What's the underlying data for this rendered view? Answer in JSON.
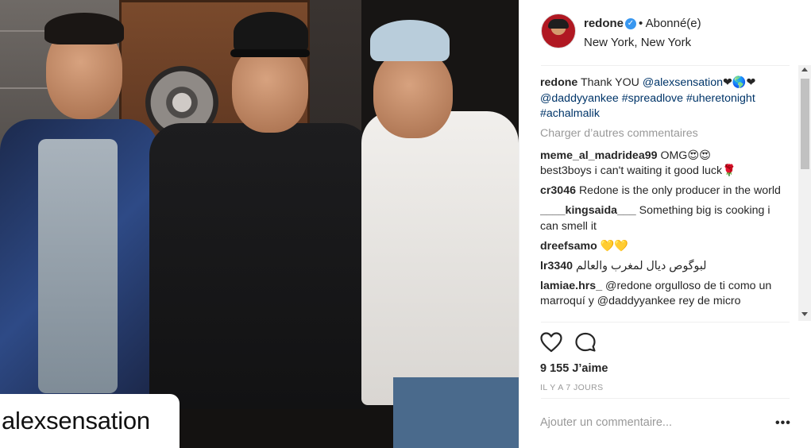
{
  "photo": {
    "overlay_text": "alexsensation"
  },
  "post": {
    "username": "redone",
    "verified_mark": "✓",
    "follow_state": "• Abonné(e)",
    "location": "New York, New York"
  },
  "comments": {
    "caption": {
      "user": "redone",
      "text": "Thank YOU",
      "mention": "@alexsensation",
      "emoji": "❤🌎❤",
      "tags": "@daddyyankee #spreadlove #uheretonight #achalmalik"
    },
    "load_more": "Charger d’autres commentaires",
    "items": [
      {
        "user": "meme_al_madridea99",
        "text": "OMG😍😍"
      },
      {
        "user": "best3boys",
        "text": "i can't waiting it good luck🌹"
      },
      {
        "user": "cr3046",
        "text": "Redone is the only producer in the world"
      },
      {
        "user": "____kingsaida___",
        "text": "Something big is cooking i can smell it"
      },
      {
        "user": "dreefsamo",
        "text": "💛💛"
      },
      {
        "user": "lr3340",
        "text": "لبوگوص ديال لمغرب والعالم"
      },
      {
        "user": "lamiae.hrs_",
        "text": "@redone orgulloso de ti como un marroquí y @daddyyankee rey de micro"
      }
    ]
  },
  "actions": {
    "like_icon": "heart-outline-icon",
    "comment_icon": "speech-bubble-icon",
    "likes_text": "9 155 J’aime",
    "time_text": "IL Y A 7 JOURS",
    "add_comment_placeholder": "Ajouter un commentaire...",
    "more_label": "•••"
  },
  "colors": {
    "link": "#003569",
    "muted": "#999999",
    "verified": "#3897f0",
    "text": "#262626"
  }
}
